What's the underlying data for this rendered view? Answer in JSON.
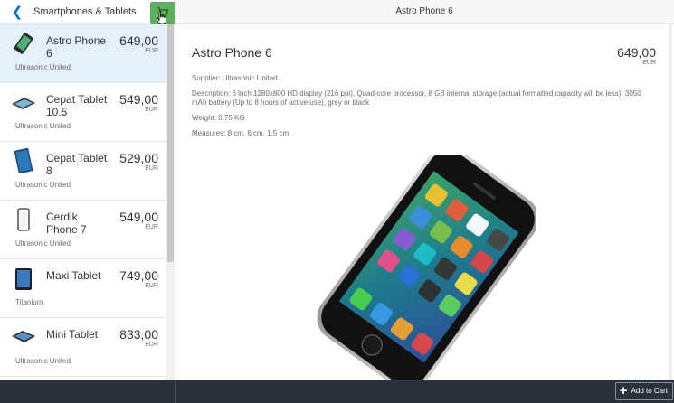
{
  "master": {
    "back_icon": "chevron-left-icon",
    "title": "Smartphones & Tablets",
    "cart_icon": "cart-icon",
    "cart_color": "#5eb05e",
    "items": [
      {
        "name": "Astro Phone 6",
        "price": "649,00",
        "currency": "EUR",
        "supplier": "Ultrasonic United",
        "selected": true
      },
      {
        "name": "Cepat Tablet 10.5",
        "price": "549,00",
        "currency": "EUR",
        "supplier": "Ultrasonic United",
        "selected": false
      },
      {
        "name": "Cepat Tablet 8",
        "price": "529,00",
        "currency": "EUR",
        "supplier": "Ultrasonic United",
        "selected": false
      },
      {
        "name": "Cerdik Phone 7",
        "price": "549,00",
        "currency": "EUR",
        "supplier": "Ultrasonic United",
        "selected": false
      },
      {
        "name": "Maxi Tablet",
        "price": "749,00",
        "currency": "EUR",
        "supplier": "Titanium",
        "selected": false
      },
      {
        "name": "Mini Tablet",
        "price": "833,00",
        "currency": "EUR",
        "supplier": "Ultrasonic United",
        "selected": false
      }
    ]
  },
  "detail": {
    "header_title": "Astro Phone 6",
    "title": "Astro Phone 6",
    "price": "649,00",
    "currency": "EUR",
    "supplier": "Supplier: Ultrasonic United",
    "description": "Description: 6 inch 1280x800 HD display (216 ppi), Quad-core processor, 8 GB internal storage (actual formatted capacity will be less), 3050 mAh battery (Up to 8 hours of active use), grey or black",
    "weight": "Weight: 0.75 KG",
    "measures": "Measures: 8 cm, 6 cm, 1.5 cm"
  },
  "footer": {
    "add_to_cart_label": "Add to Cart",
    "add_icon": "plus-icon"
  },
  "colors": {
    "footer_bg": "#2b3139",
    "selected_bg": "#e5f0fa",
    "accent": "#0a6ed1"
  }
}
